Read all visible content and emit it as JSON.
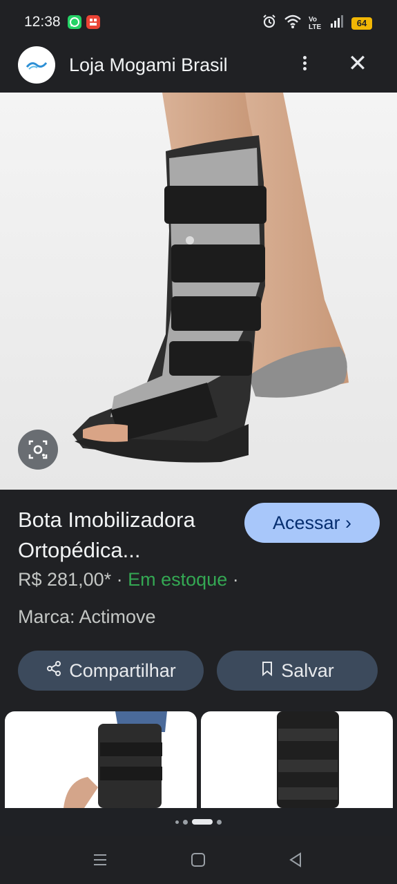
{
  "status_bar": {
    "time": "12:38",
    "battery": "64",
    "network_label": "Vo LTE"
  },
  "header": {
    "title": "Loja Mogami Brasil"
  },
  "product": {
    "title": "Bota Imobilizadora Ortopédica...",
    "access_label": "Acessar",
    "price": "R$ 281,00*",
    "separator": "·",
    "stock": "Em estoque",
    "brand": "Marca: Actimove"
  },
  "actions": {
    "share_label": "Compartilhar",
    "save_label": "Salvar"
  },
  "colors": {
    "background": "#202124",
    "accent_button": "#a8c7fa",
    "stock_green": "#34a853",
    "pill_bg": "#3c4a5c"
  },
  "icons": [
    "whatsapp-icon",
    "app-notification-icon",
    "alarm-icon",
    "wifi-icon",
    "signal-icon",
    "battery-icon",
    "more-vert-icon",
    "close-icon",
    "lens-search-icon",
    "share-icon",
    "bookmark-icon",
    "chevron-right-icon",
    "recent-apps-icon",
    "home-icon",
    "back-icon"
  ]
}
